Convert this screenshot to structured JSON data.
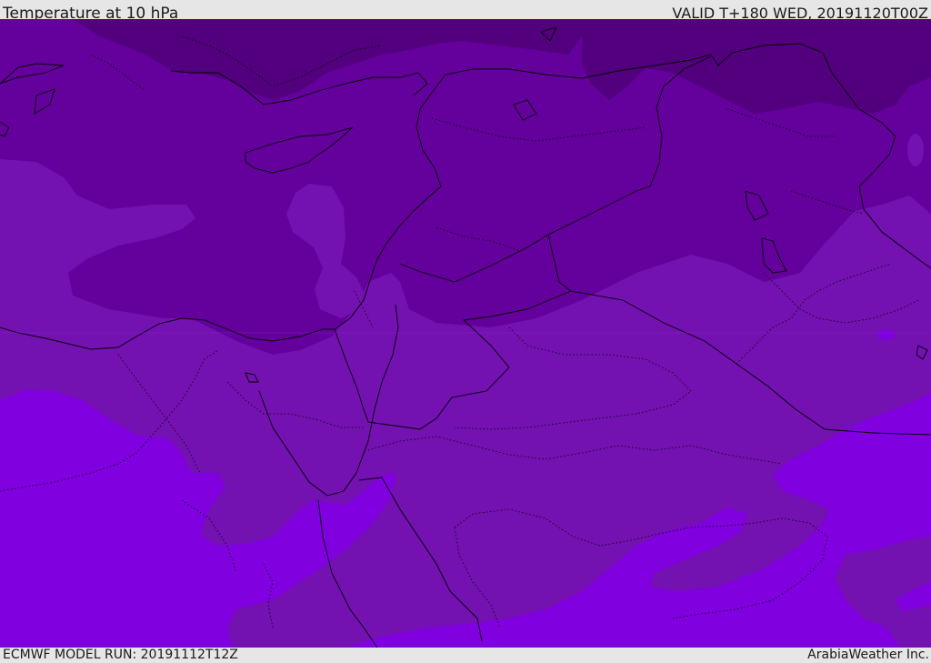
{
  "header": {
    "title": "Temperature at 10 hPa",
    "valid": "VALID T+180 WED, 20191120T00Z"
  },
  "footer": {
    "model_run": "ECMWF MODEL RUN: 20191112T12Z",
    "brand": "ArabiaWeather Inc."
  },
  "map": {
    "colors": {
      "band_darkest": "#52007d",
      "band_dark": "#64009b",
      "band_mid": "#7411b1",
      "band_bright": "#8000df",
      "borders": "#000000"
    }
  }
}
